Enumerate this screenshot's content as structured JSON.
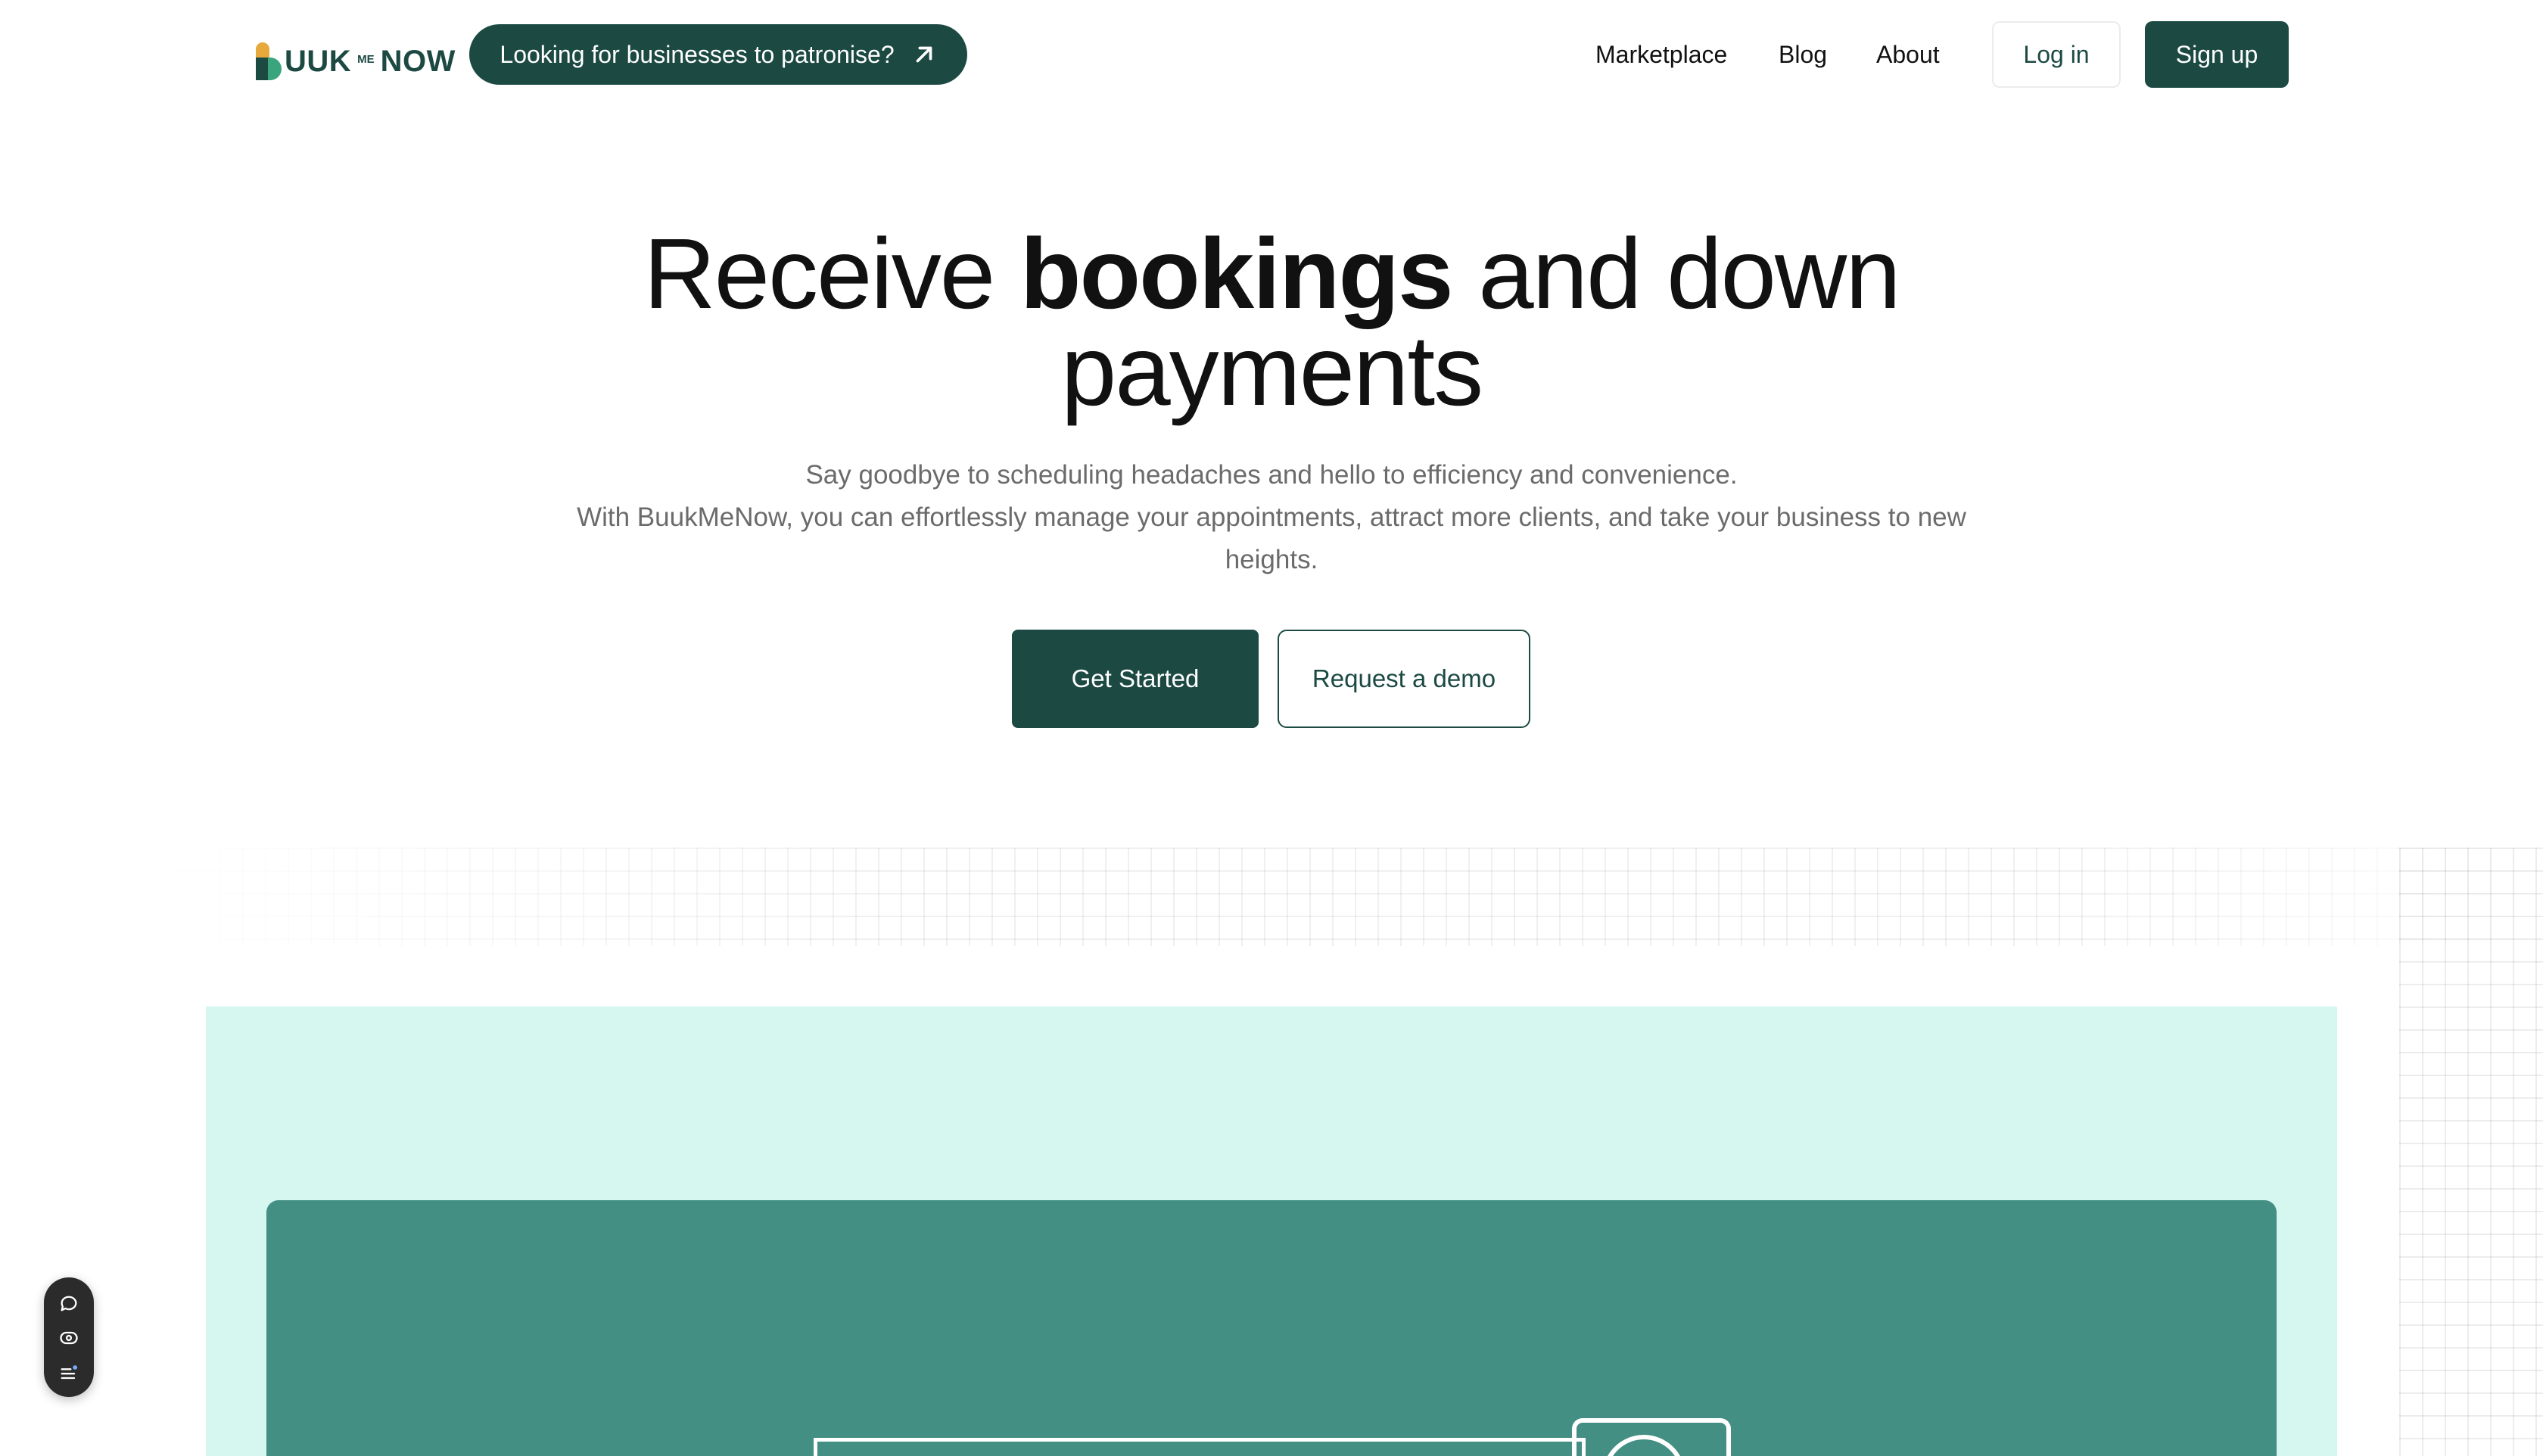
{
  "header": {
    "logo": {
      "left_text": "UUK",
      "me_text": "ME",
      "right_text": "NOW"
    },
    "promo_pill": {
      "label": "Looking for businesses to patronise?",
      "icon": "arrow-up-right-icon"
    },
    "nav": [
      {
        "label": "Marketplace"
      },
      {
        "label": "Blog"
      },
      {
        "label": "About"
      }
    ],
    "login_label": "Log in",
    "signup_label": "Sign up"
  },
  "hero": {
    "title_prefix": "Receive ",
    "title_bold": "bookings",
    "title_suffix": " and down",
    "title_line2": "payments",
    "subtitle_line1": "Say goodbye to scheduling headaches and hello to efficiency and convenience.",
    "subtitle_line2": "With BuukMeNow, you can effortlessly manage your appointments, attract more clients, and take your business to new heights.",
    "primary_cta": "Get Started",
    "secondary_cta": "Request a demo"
  },
  "floating_toolbar": {
    "icons": [
      "chat-bubble-icon",
      "eye-icon",
      "list-icon"
    ]
  },
  "colors": {
    "brand_dark": "#1c4a43",
    "brand_green": "#3aa57d",
    "brand_yellow": "#e8a93c",
    "preview_bg": "#d6f7ef",
    "preview_card": "#438f84",
    "subtitle_gray": "#6b6b6b"
  }
}
